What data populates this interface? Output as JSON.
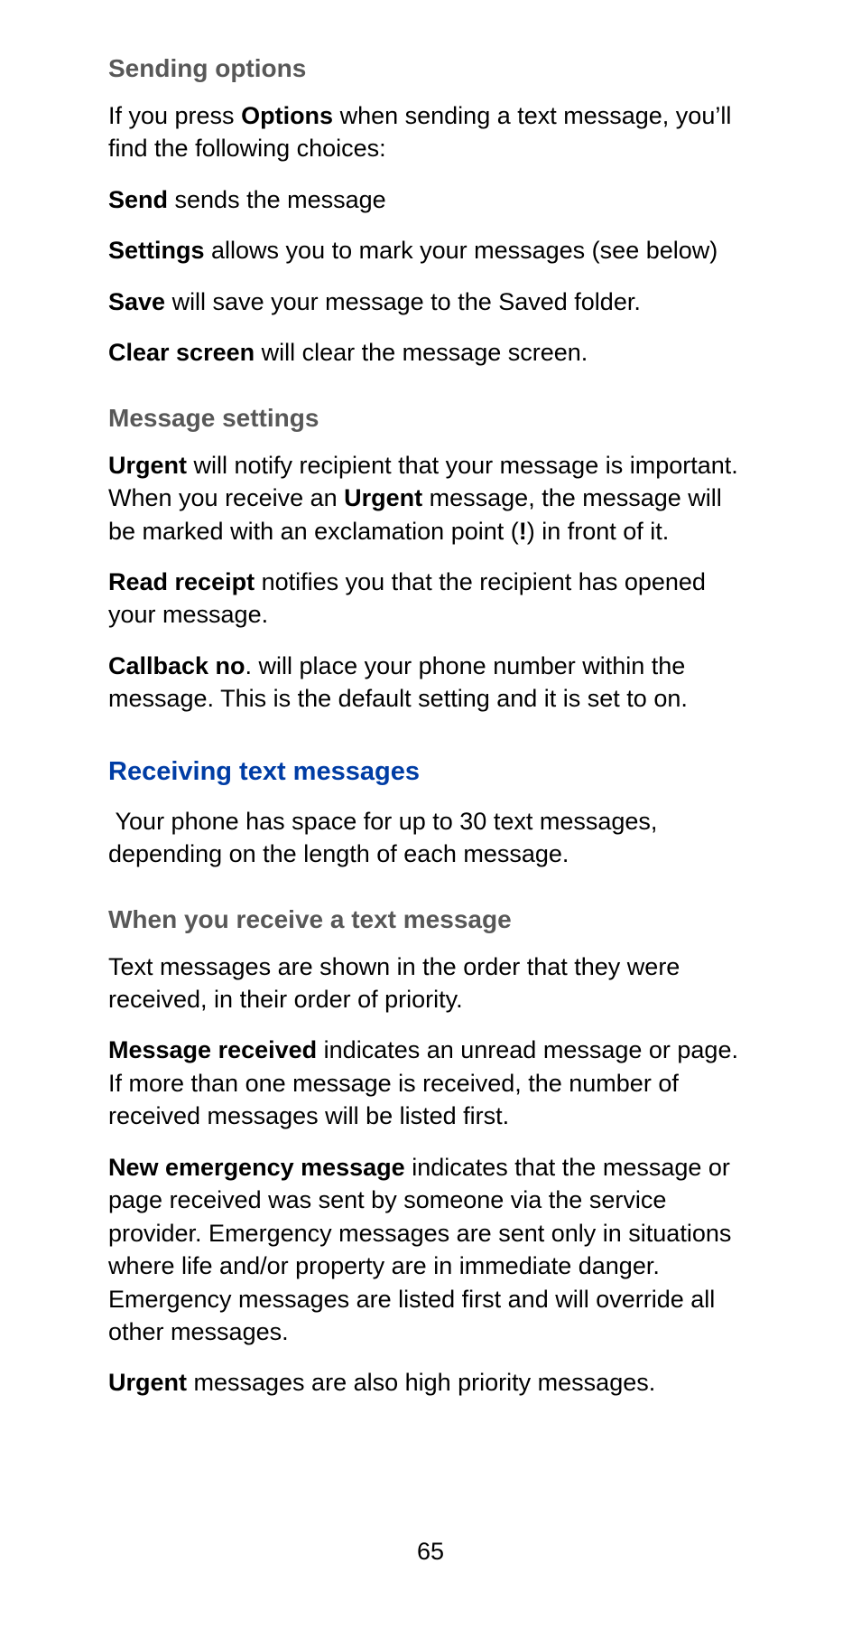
{
  "sending_options": {
    "heading": "Sending options",
    "intro_a": "If you press ",
    "intro_b": "Options",
    "intro_c": " when sending a text message, you’ll find the following choices:",
    "send_a": "Send",
    "send_b": " sends the message",
    "settings_a": "Settings",
    "settings_b": " allows you to mark your messages (see below)",
    "save_a": "Save",
    "save_b": " will save your message to the Saved folder.",
    "clear_a": "Clear screen",
    "clear_b": " will clear the message screen."
  },
  "message_settings": {
    "heading": "Message settings",
    "urgent_a": "Urgent",
    "urgent_b": " will notify recipient that your message is important. When you receive an ",
    "urgent_c": "Urgent",
    "urgent_d": " message, the message will be marked with an exclamation point (",
    "urgent_e": "!",
    "urgent_f": ") in front of it.",
    "read_a": "Read receipt",
    "read_b": " notifies you that the recipient has opened your message.",
    "callback_a": "Callback no",
    "callback_b": ". will place your phone number within the message. This is the default setting and it is set to on."
  },
  "receiving": {
    "heading": "Receiving text messages",
    "intro": " Your phone has space for up to 30 text messages, depending on the length of each message."
  },
  "when_receive": {
    "heading": "When you receive a text message",
    "p1": "Text messages are shown in the order that they were received, in their order of priority.",
    "msg_a": "Message received",
    "msg_b": " indicates an unread message or page. If more than one message is received, the number of received messages will be listed first.",
    "emg_a": "New emergency message",
    "emg_b": " indicates that the message or page received was sent by someone via the service provider. Emergency messages are sent only in situations where life and/or property are in immediate danger. Emergency messages are listed first and will override all other messages.",
    "urg_a": "Urgent",
    "urg_b": " messages are also high priority messages."
  },
  "page_number": "65"
}
